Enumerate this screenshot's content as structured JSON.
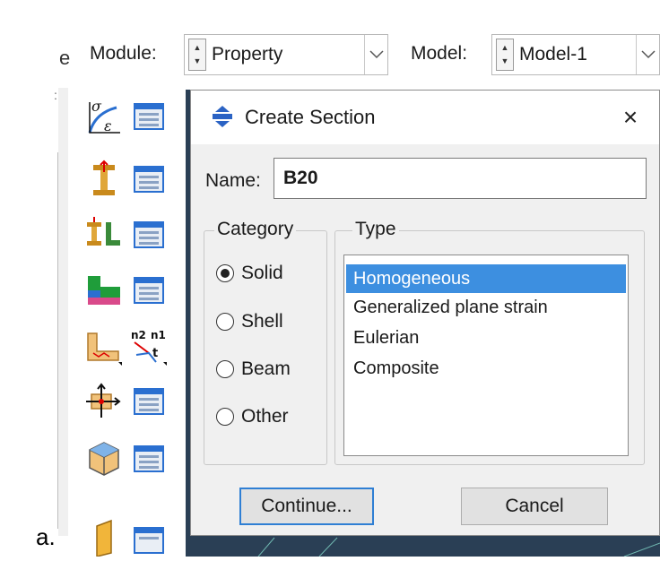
{
  "figure_label": "a.",
  "left_edge": {
    "cut_text": "e",
    "cut_mark": ":"
  },
  "toolbar": {
    "module_label": "Module:",
    "module_value": "Property",
    "model_label": "Model:",
    "model_value": "Model-1"
  },
  "toolbox": [
    {
      "icon": "create-material-icon",
      "manager": "material-manager-icon"
    },
    {
      "icon": "create-section-icon",
      "manager": "section-manager-icon"
    },
    {
      "icon": "create-profile-icon",
      "manager": "profile-manager-icon"
    },
    {
      "icon": "assign-section-icon",
      "manager": "section-assignment-manager-icon"
    },
    {
      "icon": "assign-beam-orientation-icon",
      "manager": "assign-normal-tangent-icon"
    },
    {
      "icon": "special-inertia-icon",
      "manager": "inertia-manager-icon"
    },
    {
      "icon": "skin-icon",
      "manager": "skin-manager-icon"
    },
    {
      "icon": "stringer-icon",
      "manager": "stringer-manager-icon"
    }
  ],
  "dialog": {
    "title": "Create Section",
    "close_glyph": "×",
    "name_label": "Name:",
    "name_value": "B20",
    "category_title": "Category",
    "categories": [
      {
        "label": "Solid",
        "selected": true
      },
      {
        "label": "Shell",
        "selected": false
      },
      {
        "label": "Beam",
        "selected": false
      },
      {
        "label": "Other",
        "selected": false
      }
    ],
    "type_title": "Type",
    "types": [
      {
        "label": "Homogeneous",
        "selected": true
      },
      {
        "label": "Generalized plane strain",
        "selected": false
      },
      {
        "label": "Eulerian",
        "selected": false
      },
      {
        "label": "Composite",
        "selected": false
      }
    ],
    "continue_label": "Continue...",
    "cancel_label": "Cancel"
  },
  "colors": {
    "selection": "#3d8fe0",
    "focus_border": "#2f7fd4",
    "viewport": "#2a3f55"
  }
}
